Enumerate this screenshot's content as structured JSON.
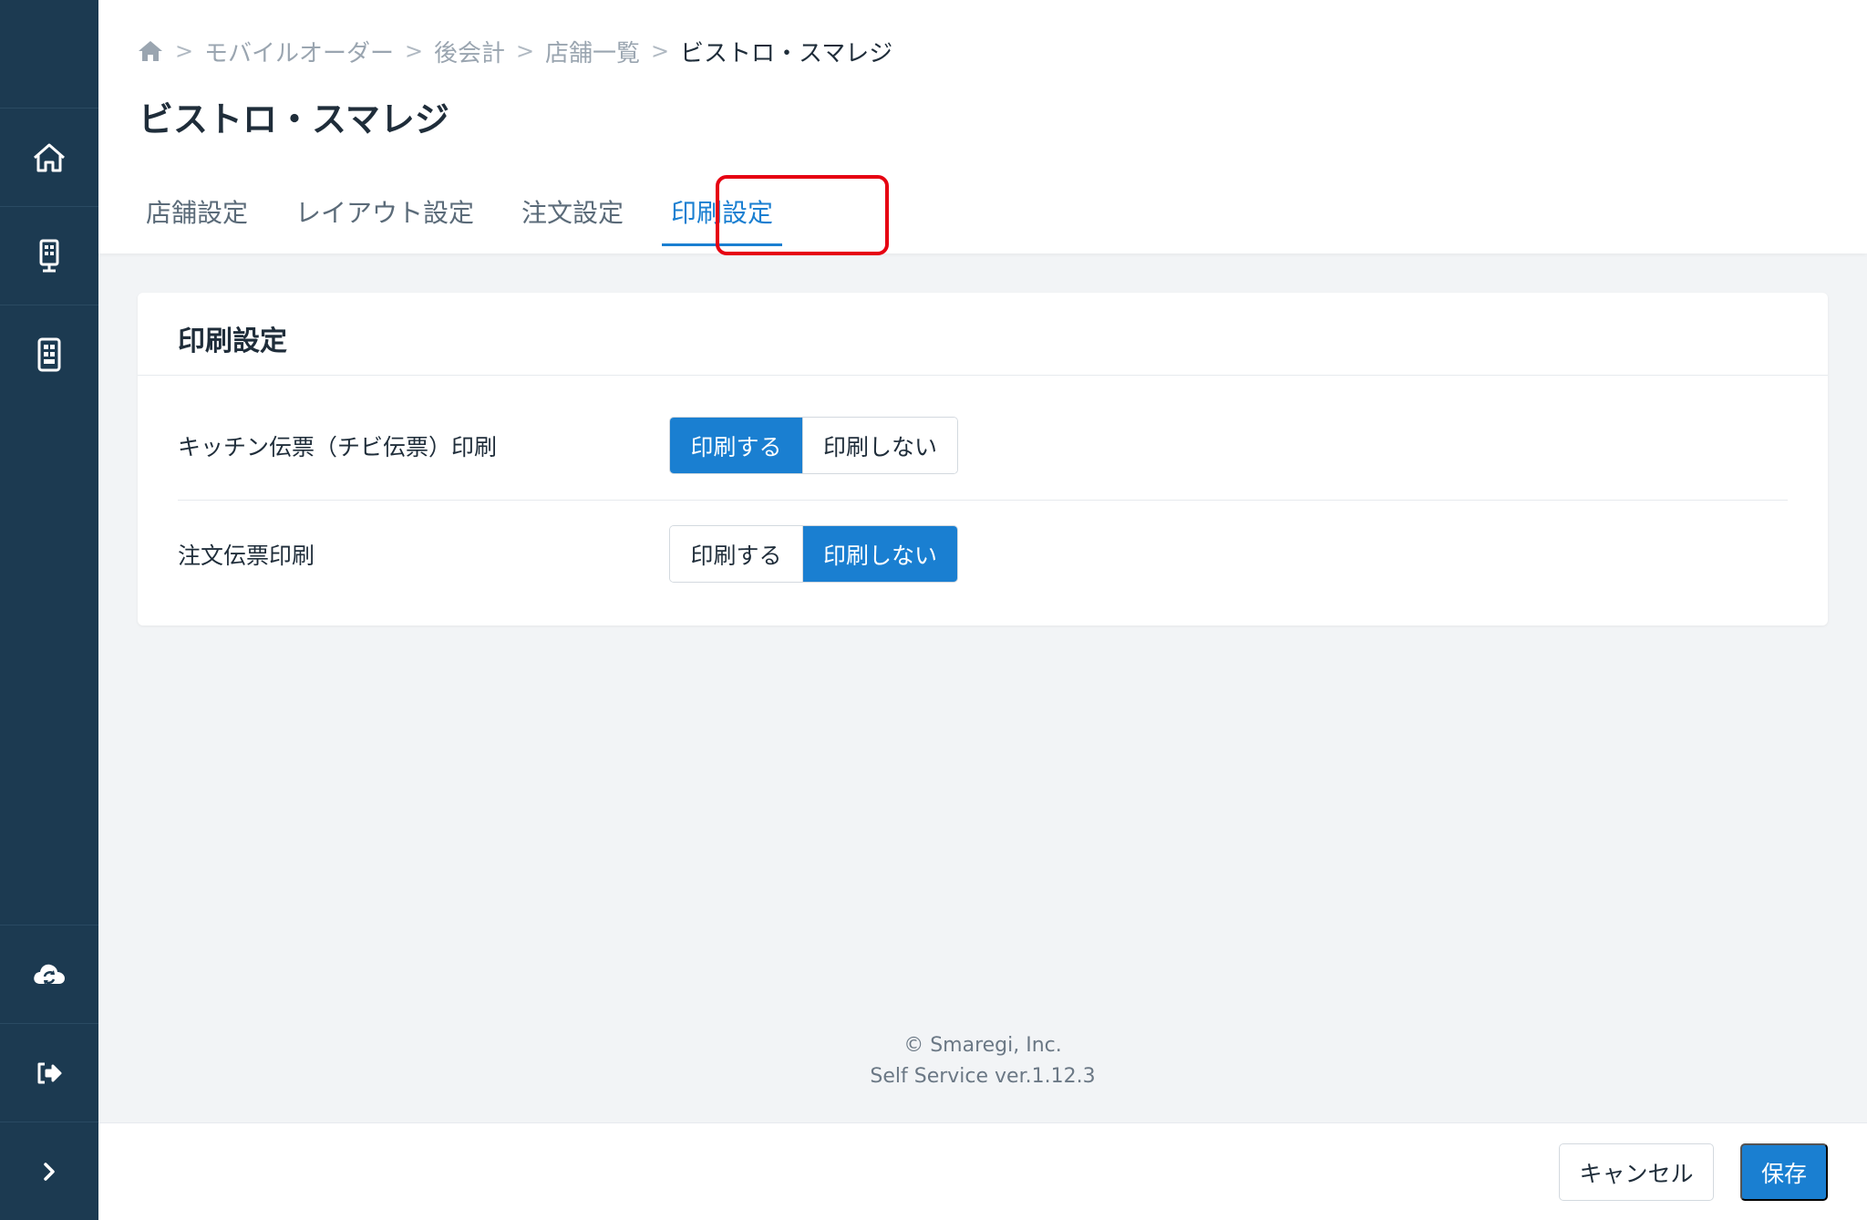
{
  "sidebar": {
    "items": [
      {
        "icon": "home-icon"
      },
      {
        "icon": "kiosk-icon"
      },
      {
        "icon": "tablet-menu-icon"
      },
      {
        "icon": "cloud-sync-icon"
      },
      {
        "icon": "logout-icon"
      },
      {
        "icon": "chevron-right-icon"
      }
    ]
  },
  "breadcrumb": {
    "items": [
      "モバイルオーダー",
      "後会計",
      "店舗一覧"
    ],
    "current": "ビストロ・スマレジ",
    "separator": ">"
  },
  "page": {
    "title": "ビストロ・スマレジ"
  },
  "tabs": [
    {
      "label": "店舗設定"
    },
    {
      "label": "レイアウト設定"
    },
    {
      "label": "注文設定"
    },
    {
      "label": "印刷設定"
    }
  ],
  "active_tab": "印刷設定",
  "card": {
    "title": "印刷設定",
    "rows": [
      {
        "label": "キッチン伝票（チビ伝票）印刷",
        "options": [
          "印刷する",
          "印刷しない"
        ],
        "selected": "印刷する"
      },
      {
        "label": "注文伝票印刷",
        "options": [
          "印刷する",
          "印刷しない"
        ],
        "selected": "印刷しない"
      }
    ]
  },
  "footer": {
    "copyright": "© Smaregi, Inc.",
    "version": "Self Service ver.1.12.3"
  },
  "actions": {
    "cancel_label": "キャンセル",
    "save_label": "保存"
  },
  "colors": {
    "sidebar": "#1c3a51",
    "accent": "#1a7fd1",
    "highlight": "#e60012"
  }
}
